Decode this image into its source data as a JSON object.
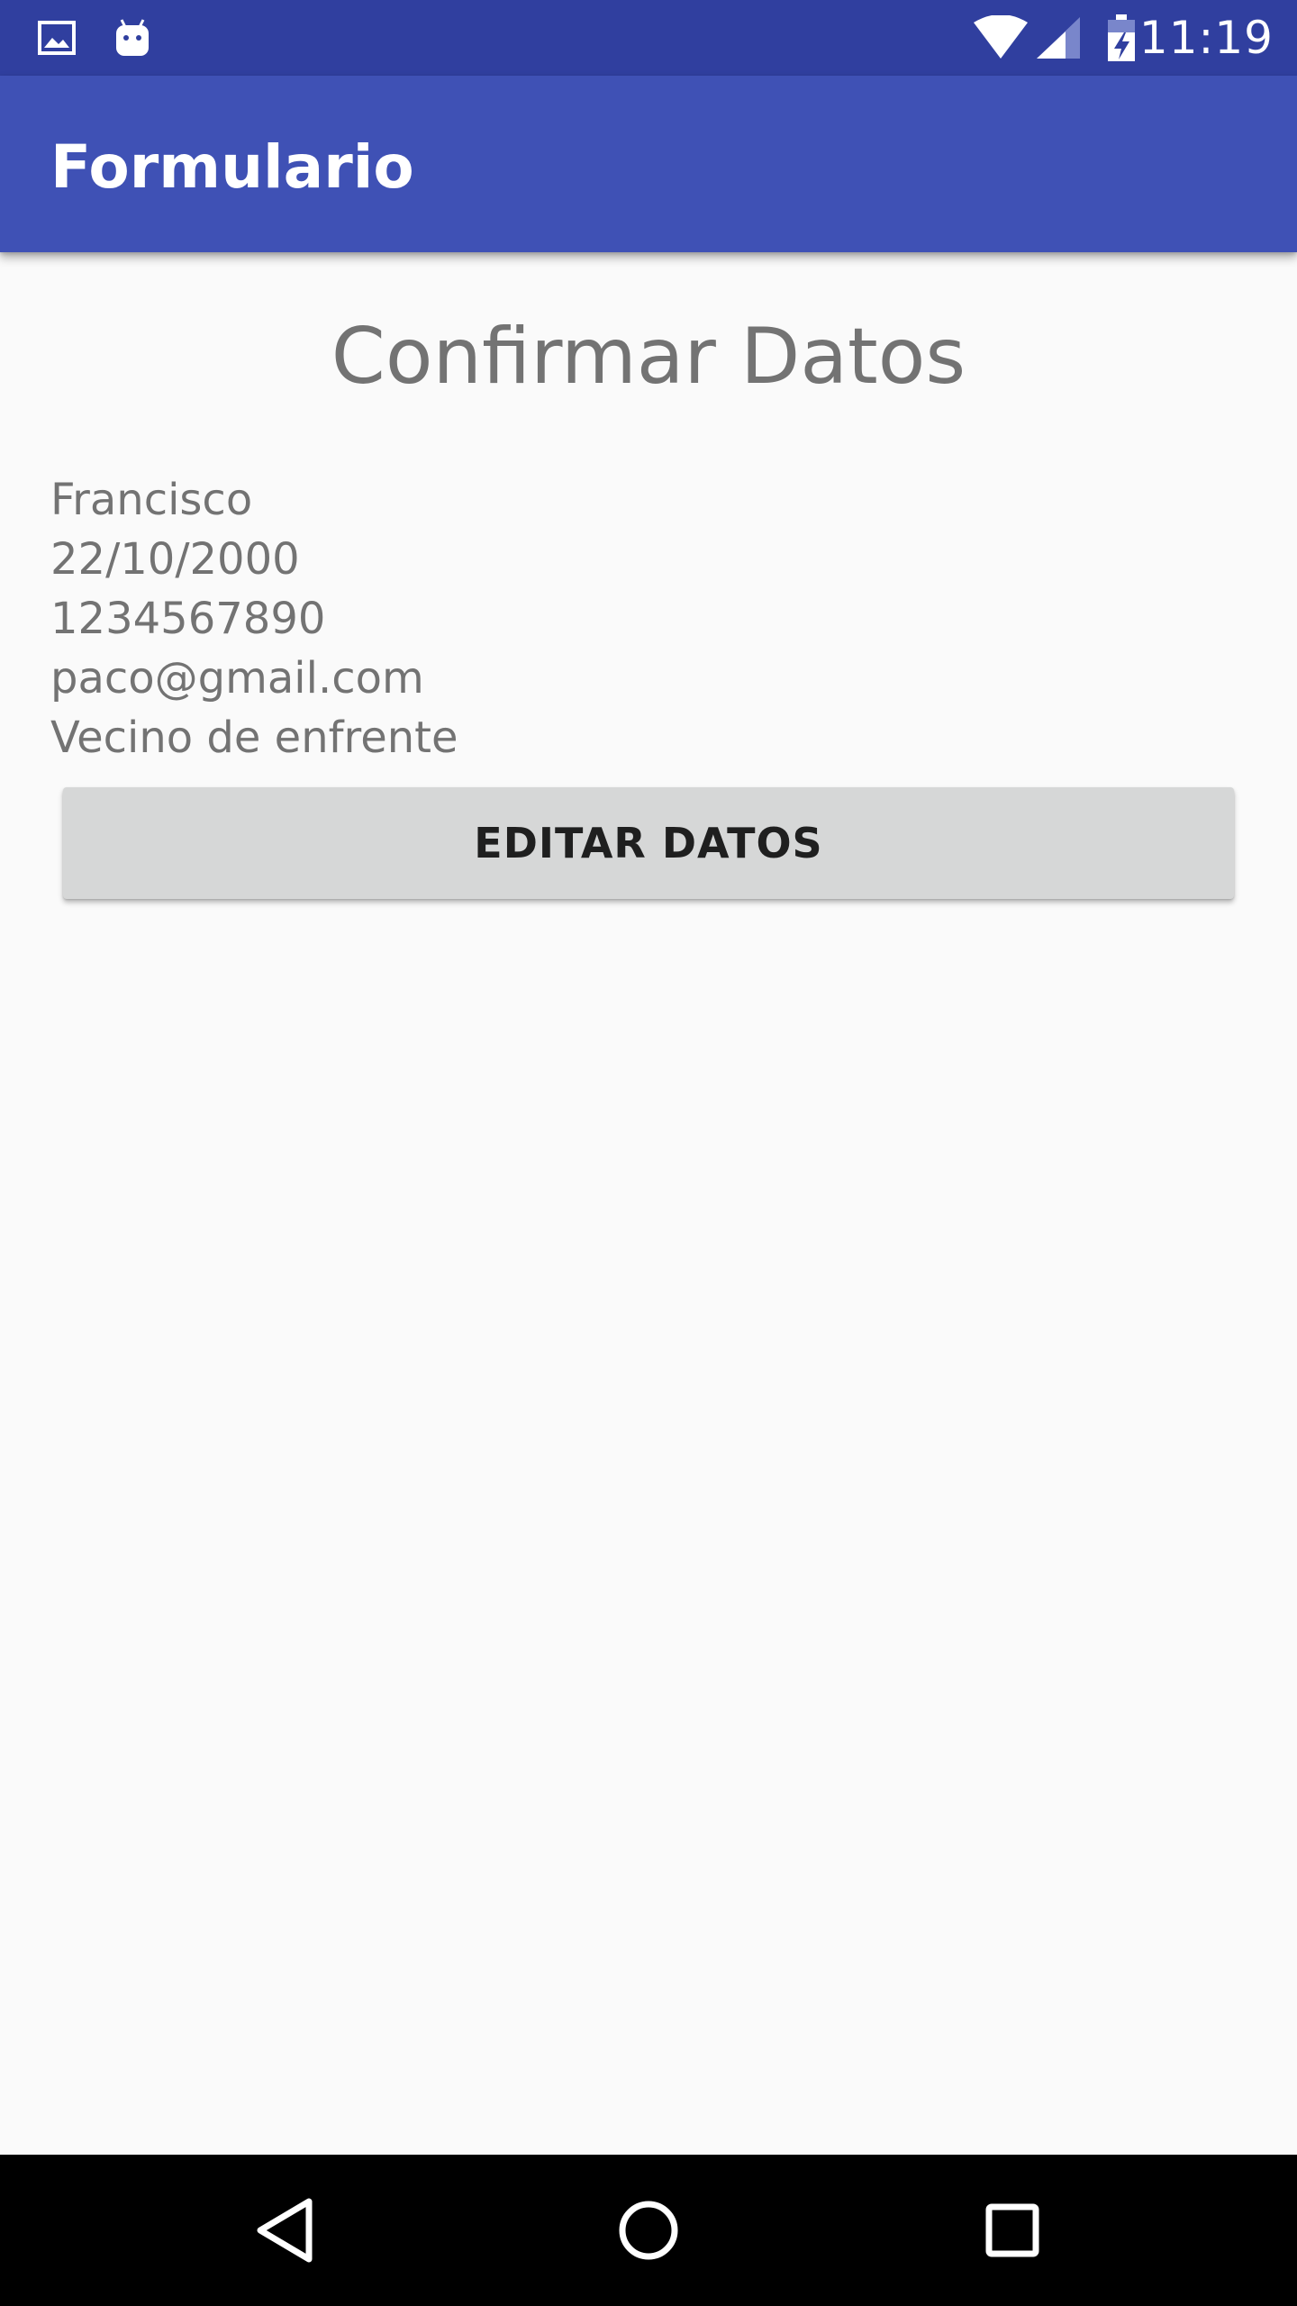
{
  "status_bar": {
    "time": "11:19",
    "left_icons": [
      "image-notification-icon",
      "android-notification-icon"
    ],
    "right_icons": [
      "wifi-icon",
      "cell-signal-icon",
      "battery-charging-icon"
    ],
    "color": "#303f9f"
  },
  "app_bar": {
    "title": "Formulario",
    "color": "#3f51b5"
  },
  "main": {
    "heading": "Confirmar Datos",
    "fields": [
      "Francisco",
      "22/10/2000",
      "1234567890",
      "paco@gmail.com",
      "Vecino de enfrente"
    ],
    "edit_button_label": "EDITAR DATOS"
  },
  "nav_bar": {
    "buttons": [
      "back-icon",
      "home-icon",
      "recents-icon"
    ]
  }
}
